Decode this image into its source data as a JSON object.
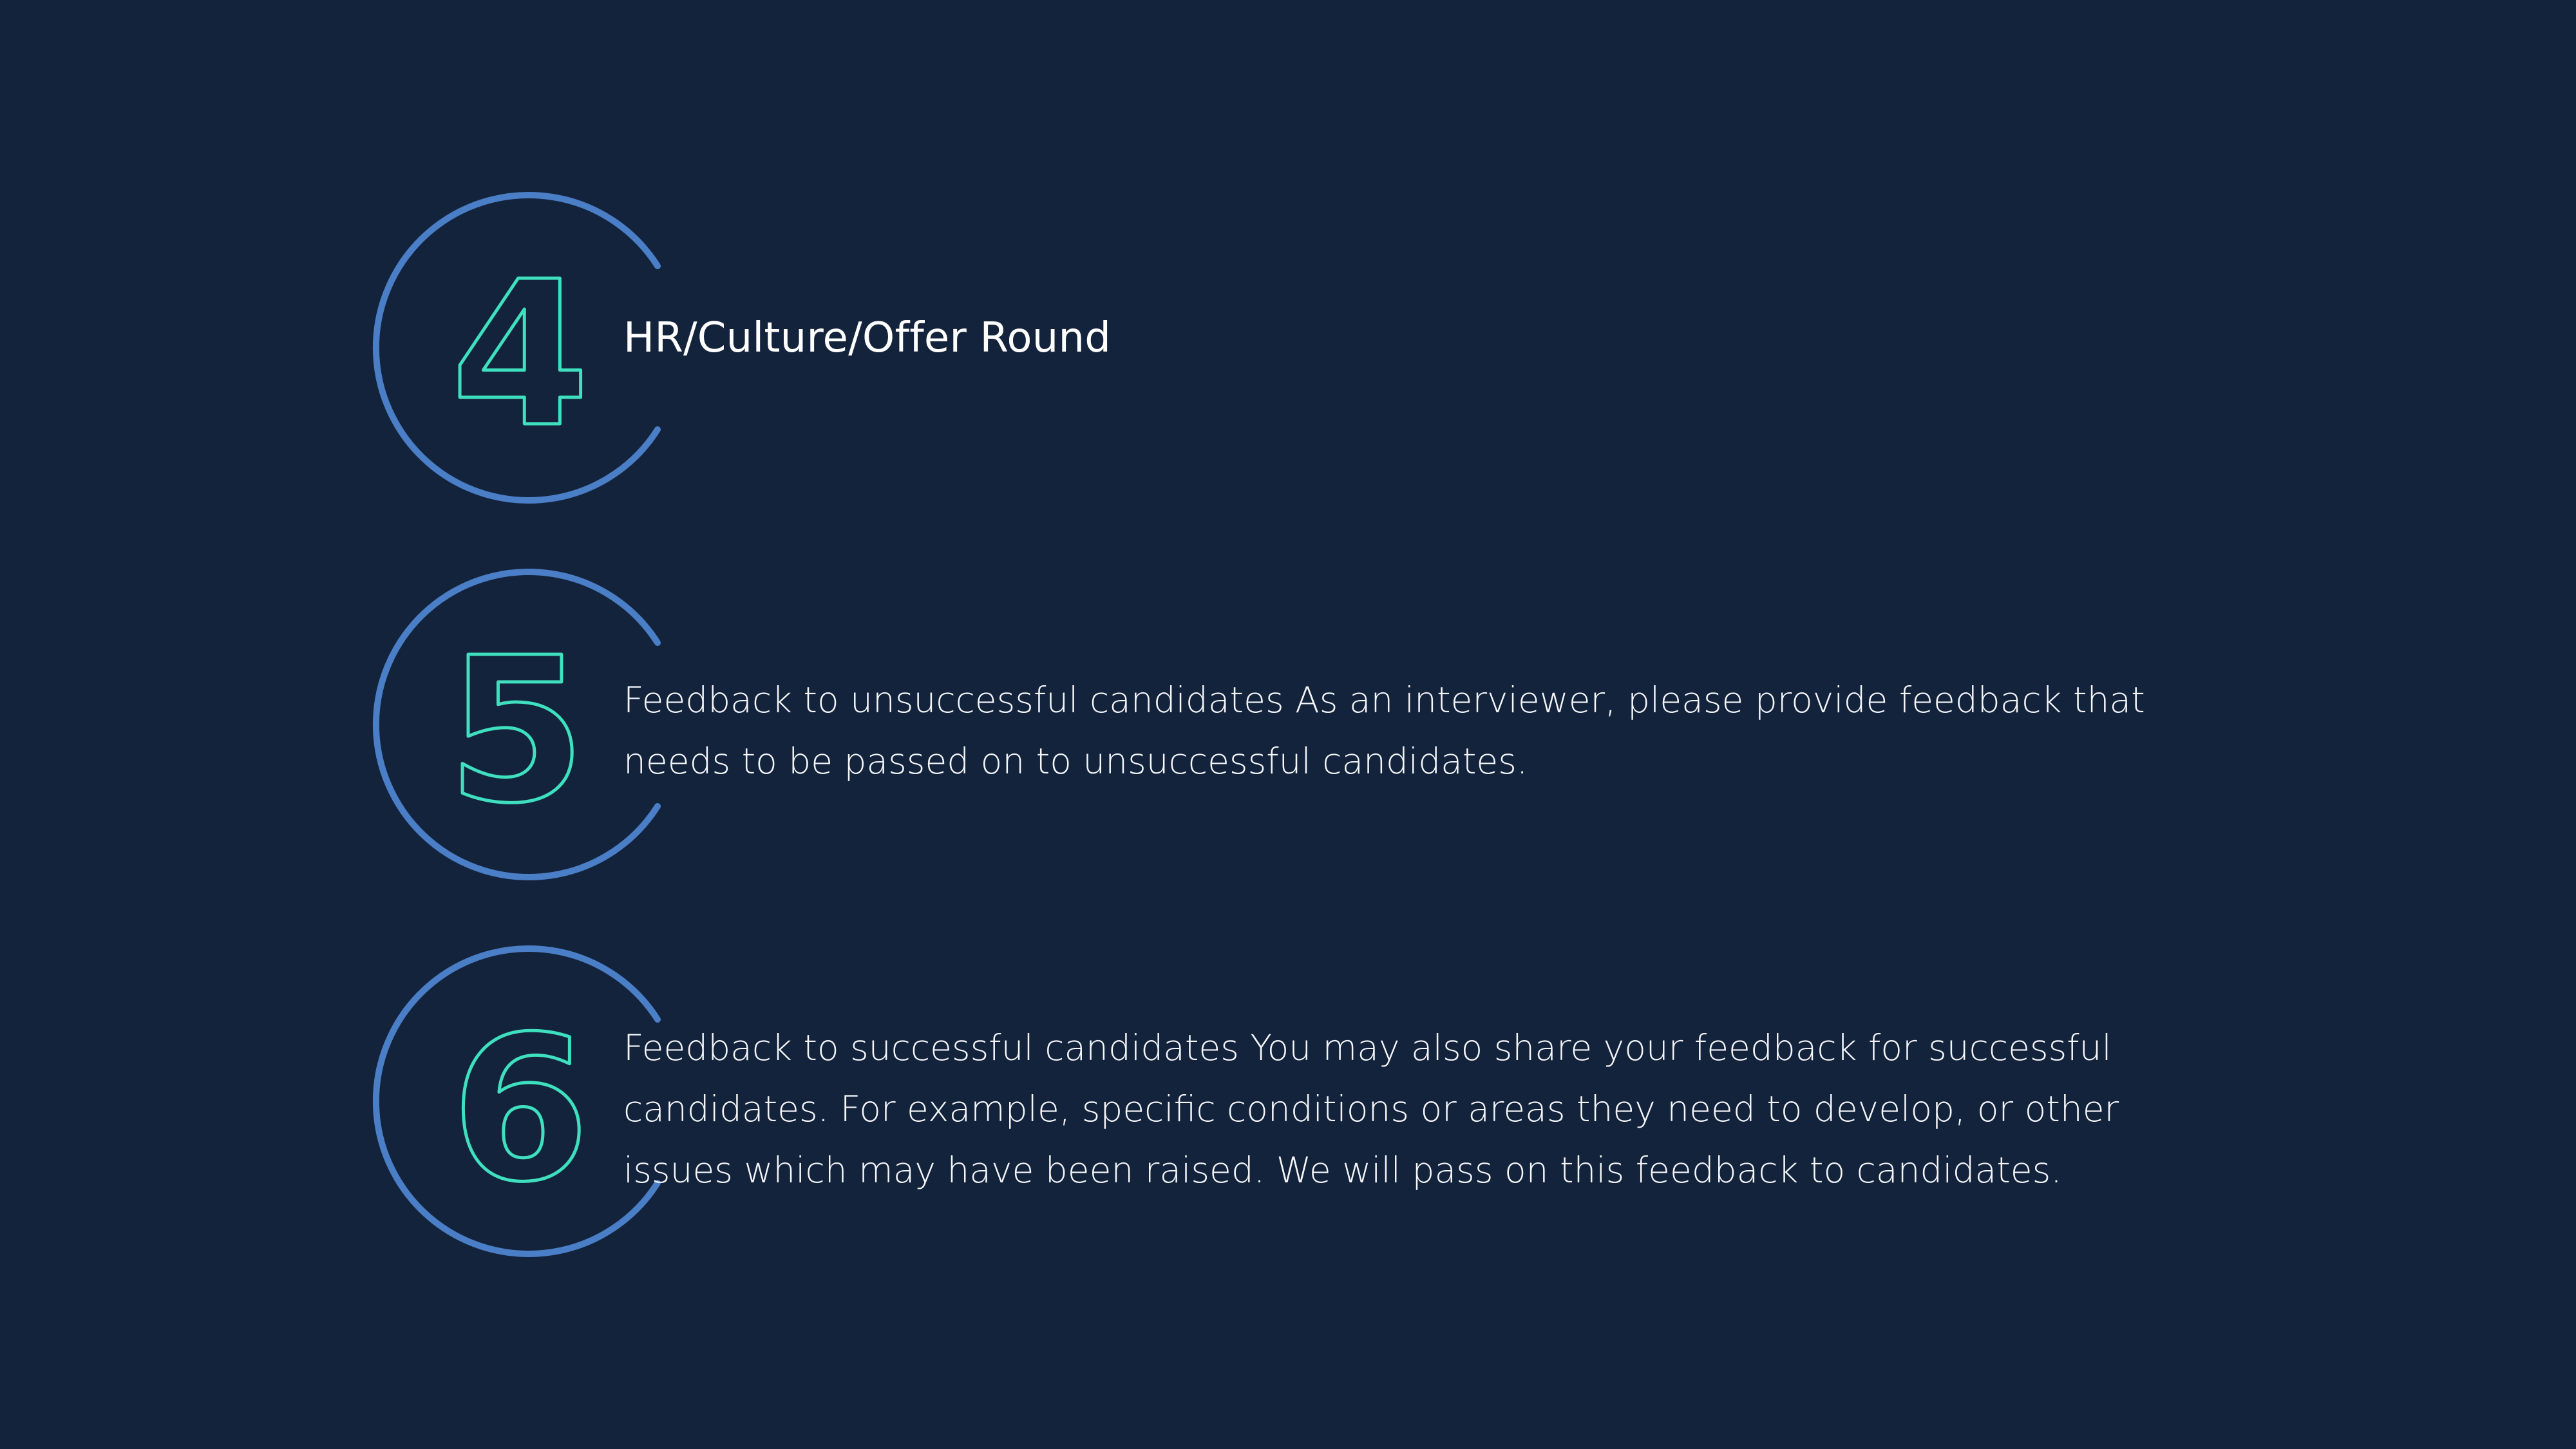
{
  "steps": [
    {
      "number": "4",
      "text": "HR/Culture/Offer Round"
    },
    {
      "number": "5",
      "text": "Feedback to unsuccessful candidates As an interviewer, please provide feedback that needs to be passed on to unsuccessful candidates."
    },
    {
      "number": "6",
      "text": "Feedback to successful candidates You may also share your feedback for successful candidates. For example, specific conditions or areas they need to develop, or other issues which may have been raised.  We will pass on this feedback to candidates."
    }
  ],
  "colors": {
    "background": "#13233b",
    "ring": "#4a7ec6",
    "numeral_outline": "#3ee0c0",
    "text": "#ffffff"
  }
}
